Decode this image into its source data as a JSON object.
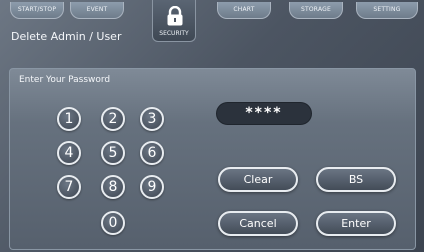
{
  "tabs": {
    "start_stop": "START/STOP",
    "event": "EVENT",
    "security": "SECURITY",
    "chart": "CHART",
    "storage": "STORAGE",
    "setting": "SETTING"
  },
  "page_title": "Delete Admin / User",
  "panel_title": "Enter Your Password",
  "password_masked": "****",
  "keypad": [
    "1",
    "2",
    "3",
    "4",
    "5",
    "6",
    "7",
    "8",
    "9",
    "0"
  ],
  "buttons": {
    "clear": "Clear",
    "backspace": "BS",
    "cancel": "Cancel",
    "enter": "Enter"
  },
  "icons": {
    "security": "lock-icon"
  }
}
